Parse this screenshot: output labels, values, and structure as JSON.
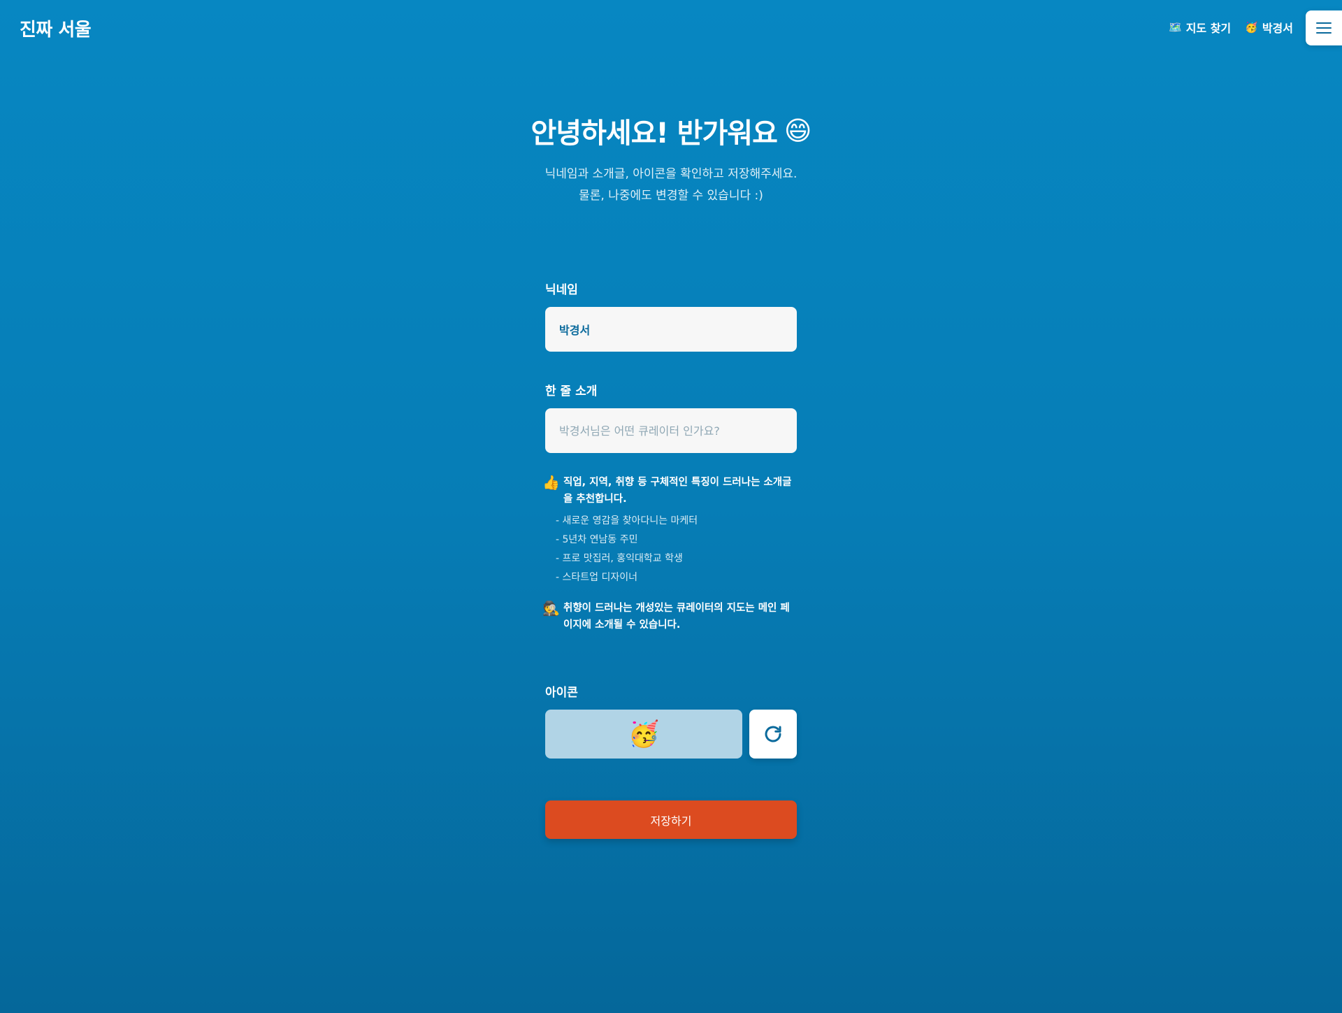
{
  "header": {
    "logo": "진짜 서울",
    "nav": [
      {
        "icon": "🗺️",
        "label": "지도 찾기"
      },
      {
        "icon": "🥳",
        "label": "박경서"
      }
    ]
  },
  "hero": {
    "title": "안녕하세요! 반가워요",
    "title_emoji": "😄",
    "subtitle_line1": "닉네임과 소개글, 아이콘을 확인하고 저장해주세요.",
    "subtitle_line2": "물론, 나중에도 변경할 수 있습니다 :)"
  },
  "form": {
    "nickname_label": "닉네임",
    "nickname_value": "박경서",
    "intro_label": "한 줄 소개",
    "intro_value": "",
    "intro_placeholder": "박경서님은 어떤 큐레이터 인가요?",
    "tip1": {
      "emoji": "👍",
      "text": "직업, 지역, 취향 등 구체적인 특징이 드러나는 소개글을 추천합니다.",
      "examples": [
        "- 새로운 영감을 찾아다니는 마케터",
        "- 5년차 연남동 주민",
        "- 프로 맛집러, 홍익대학교 학생",
        "- 스타트업 디자이너"
      ]
    },
    "tip2": {
      "emoji": "🕵️",
      "text": "취향이 드러나는 개성있는 큐레이터의 지도는 메인 페이지에 소개될 수 있습니다."
    },
    "icon_label": "아이콘",
    "icon_value": "🥳",
    "save_label": "저장하기"
  },
  "colors": {
    "background_top": "#0787c2",
    "background_bottom": "#05679a",
    "save_button": "#dc4b20",
    "accent": "#0a6a9c"
  }
}
